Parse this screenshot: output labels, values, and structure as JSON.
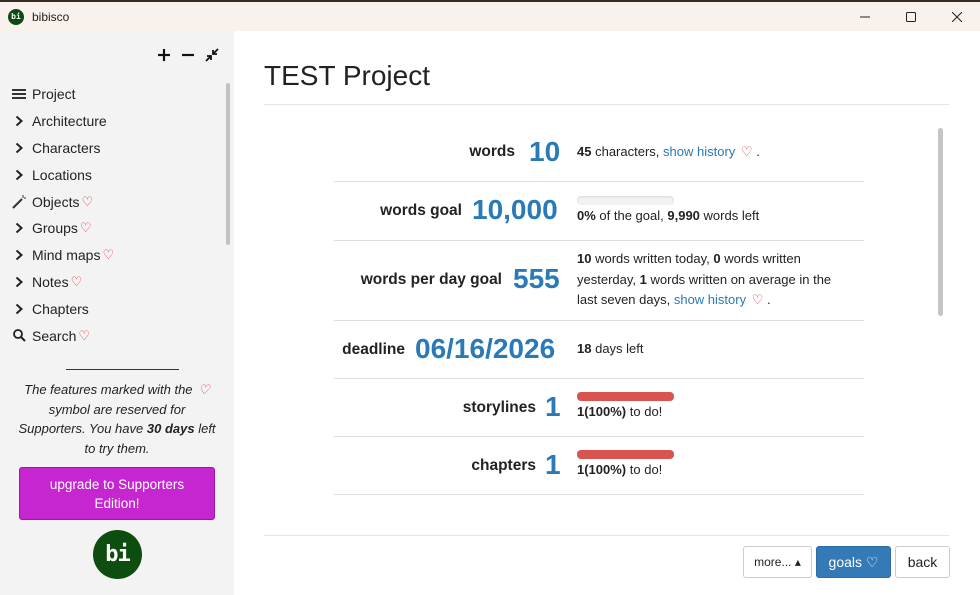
{
  "window": {
    "title": "bibisco",
    "logo_text": "bi"
  },
  "sidebar": {
    "tools": [
      "+",
      "−",
      "⤡"
    ],
    "items": [
      {
        "label": "Project",
        "icon": "list-icon",
        "heart": false
      },
      {
        "label": "Architecture",
        "icon": "chevron-right-icon",
        "heart": false
      },
      {
        "label": "Characters",
        "icon": "chevron-right-icon",
        "heart": false
      },
      {
        "label": "Locations",
        "icon": "chevron-right-icon",
        "heart": false
      },
      {
        "label": "Objects",
        "icon": "magic-wand-icon",
        "heart": true
      },
      {
        "label": "Groups",
        "icon": "chevron-right-icon",
        "heart": true
      },
      {
        "label": "Mind maps",
        "icon": "chevron-right-icon",
        "heart": true
      },
      {
        "label": "Notes",
        "icon": "chevron-right-icon",
        "heart": true
      },
      {
        "label": "Chapters",
        "icon": "chevron-right-icon",
        "heart": false
      },
      {
        "label": "Search",
        "icon": "search-icon",
        "heart": true
      }
    ],
    "note": {
      "part1": "The features marked with the",
      "part2": "symbol are reserved for Supporters. You have",
      "days": "30 days",
      "part3": "left to try them."
    },
    "upgrade_label": "upgrade to Supporters Edition!",
    "logo_text": "bi"
  },
  "main": {
    "title": "TEST Project",
    "stats": {
      "words": {
        "label": "words",
        "value": "10",
        "chars": "45",
        "chars_text": "characters,",
        "link": "show history",
        "end": "."
      },
      "words_goal": {
        "label": "words goal",
        "value": "10,000",
        "pct": "0%",
        "of_goal": "of the goal,",
        "left": "9,990",
        "left_text": "words left"
      },
      "words_per_day": {
        "label": "words per day goal",
        "value": "555",
        "today": "10",
        "today_text": "words written today,",
        "yesterday": "0",
        "yesterday_text": "words written",
        "yesterday_text2": "yesterday,",
        "avg": "1",
        "avg_text": "words written on average in the",
        "avg_text2": "last seven days,",
        "link": "show history",
        "end": "."
      },
      "deadline": {
        "label": "deadline",
        "value": "06/16/2026",
        "days": "18",
        "days_text": "days left"
      },
      "storylines": {
        "label": "storylines",
        "value": "1",
        "todo": "1(100%)",
        "todo_text": "to do!",
        "progress": 1.0
      },
      "chapters": {
        "label": "chapters",
        "value": "1",
        "todo": "1(100%)",
        "todo_text": "to do!",
        "progress": 1.0
      }
    },
    "goals_progress": 0.0
  },
  "footer": {
    "more_label": "more... ▴",
    "goals_label": "goals",
    "back_label": "back"
  },
  "colors": {
    "accent": "#2a7ab7",
    "upgrade": "#c626d0",
    "heart": "#d9363e",
    "todo_bar": "#d9534f"
  }
}
